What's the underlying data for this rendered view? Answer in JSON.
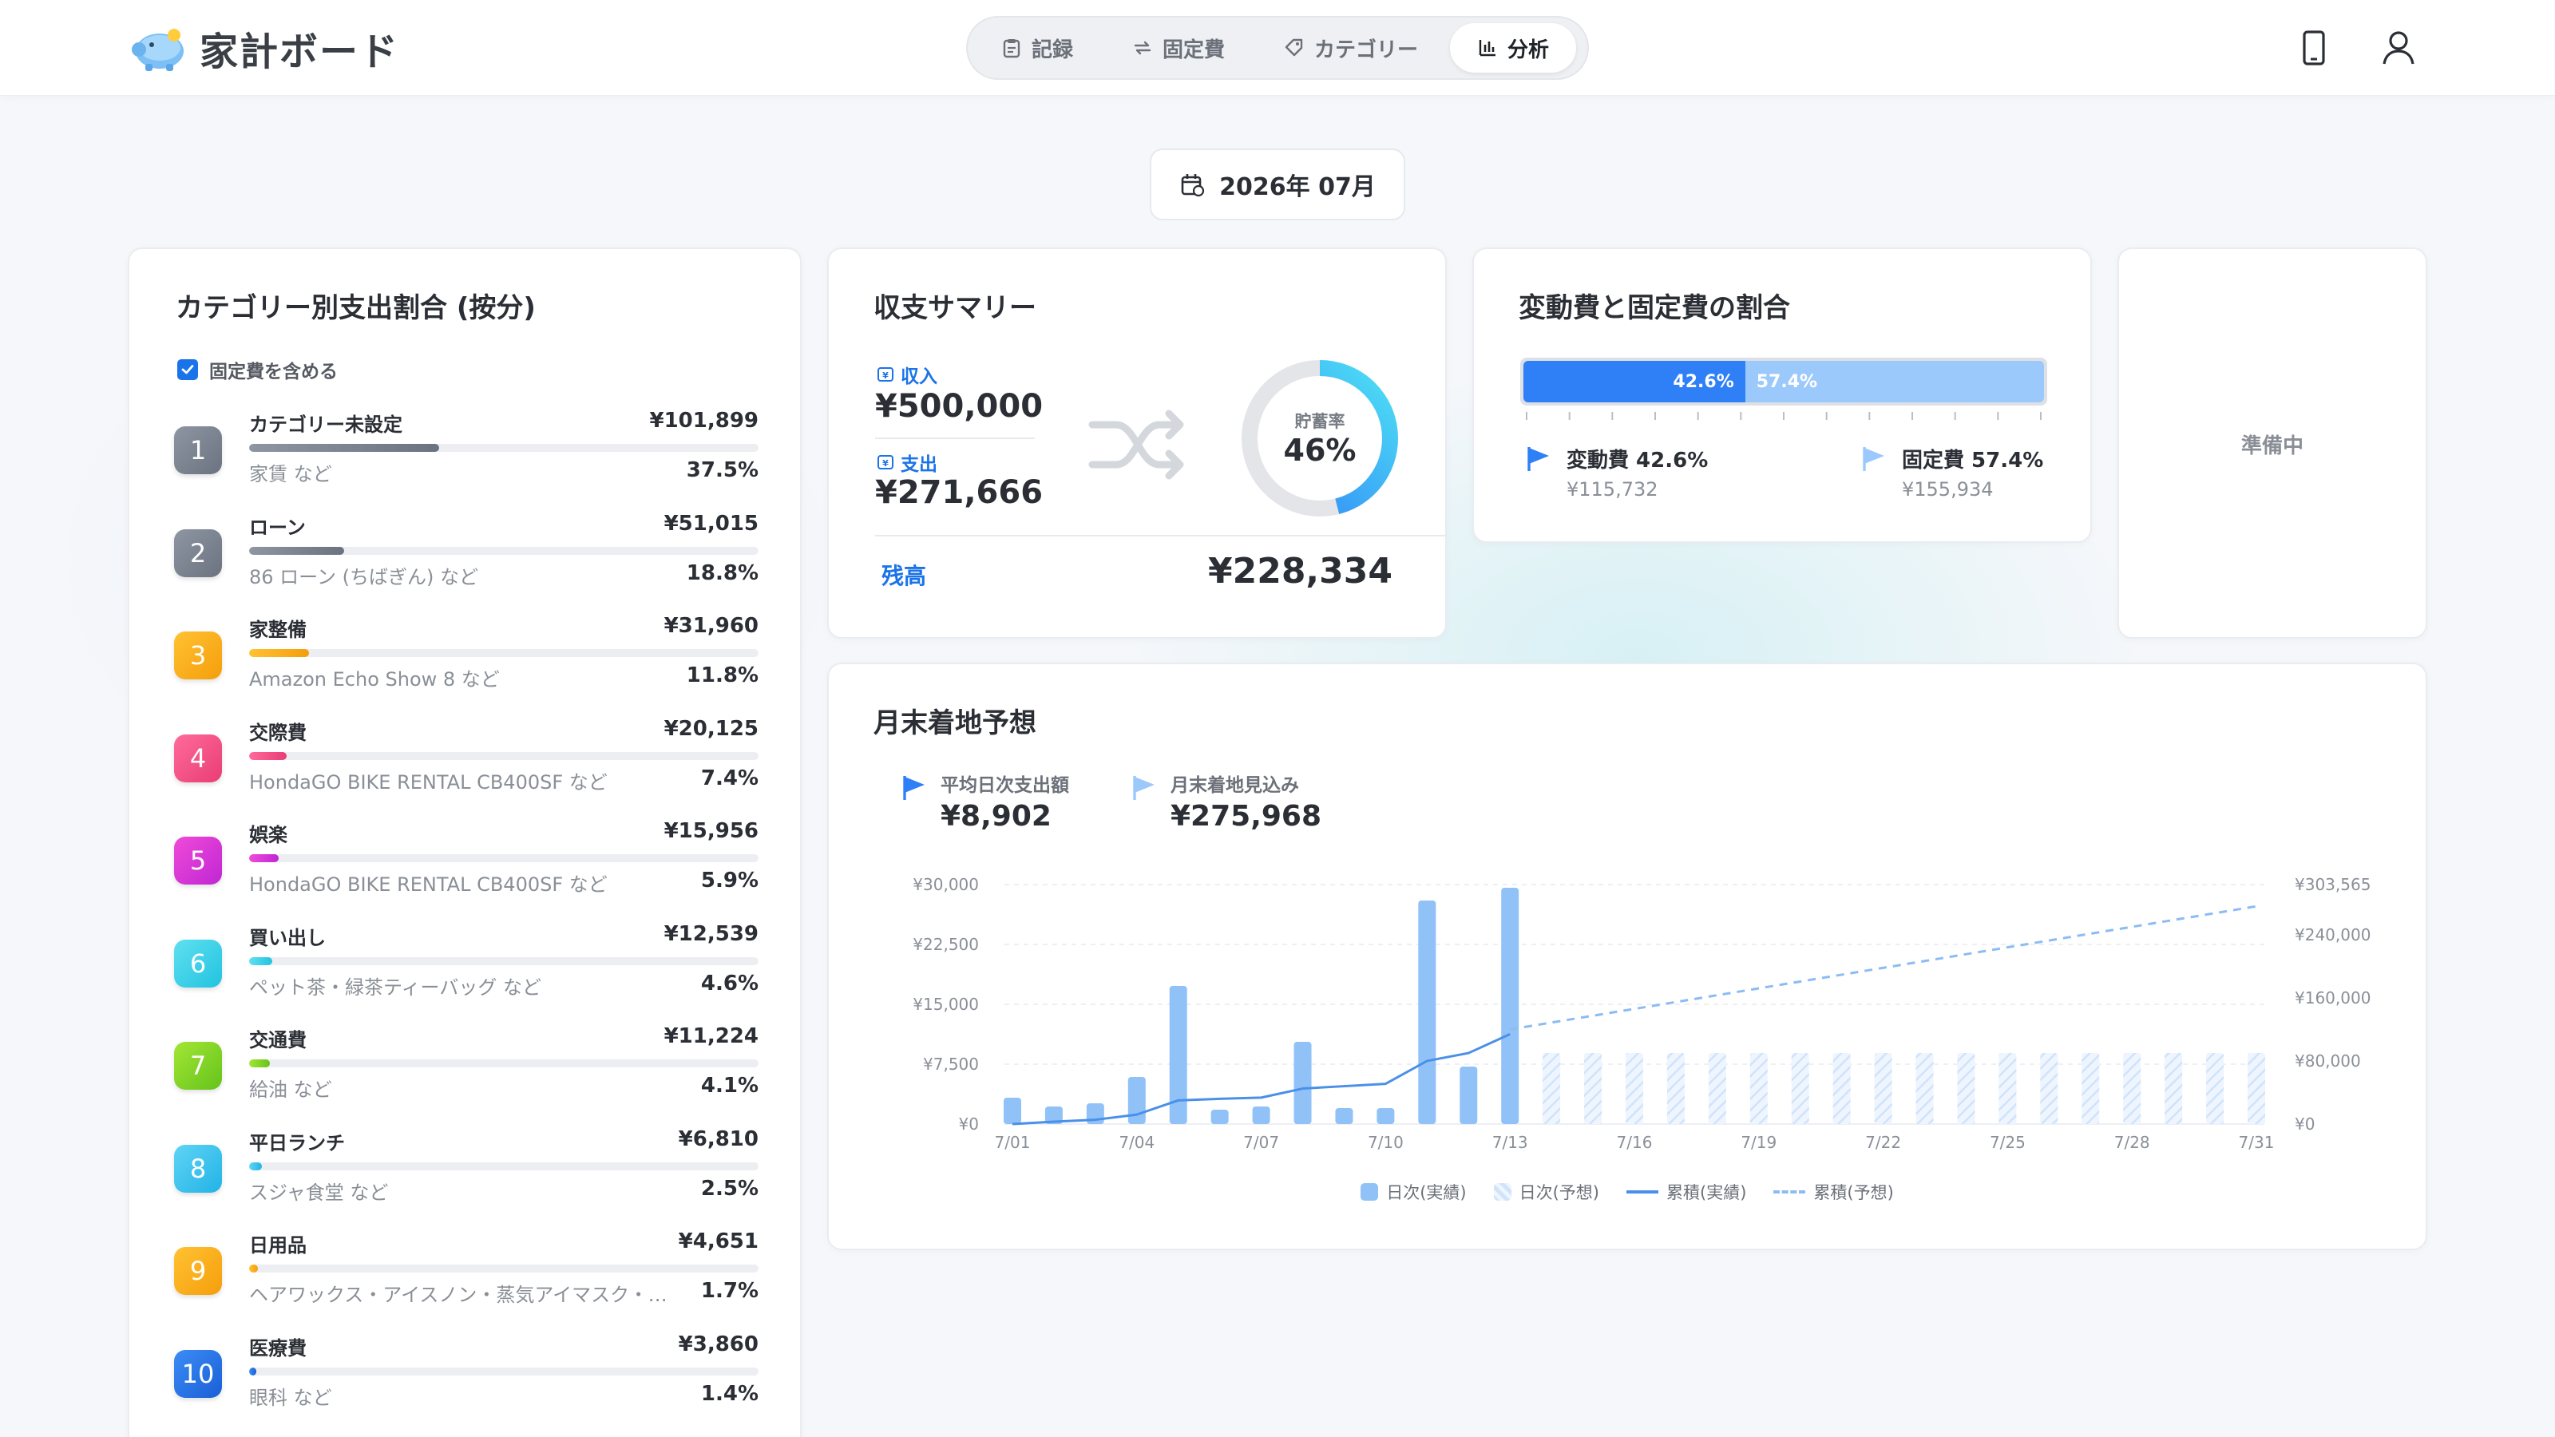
{
  "app": {
    "title": "家計ボード"
  },
  "nav": {
    "items": [
      {
        "label": "記録",
        "icon": "clipboard-icon"
      },
      {
        "label": "固定費",
        "icon": "repeat-icon"
      },
      {
        "label": "カテゴリー",
        "icon": "tag-icon"
      },
      {
        "label": "分析",
        "icon": "bar-chart-icon",
        "active": true
      }
    ]
  },
  "month": {
    "label": "2026年 07月"
  },
  "category_card": {
    "title": "カテゴリー別支出割合 (按分)",
    "checkbox_label": "固定費を含める",
    "checked": true,
    "items": [
      {
        "rank": "1",
        "name": "カテゴリー未設定",
        "amount": "¥101,899",
        "sub": "家賃 など",
        "pct": "37.5%",
        "share": 37.5,
        "color": "#8e96a3",
        "color2": "#6b7380"
      },
      {
        "rank": "2",
        "name": "ローン",
        "amount": "¥51,015",
        "sub": "86 ローン (ちばぎん) など",
        "pct": "18.8%",
        "share": 18.8,
        "color": "#8e96a3",
        "color2": "#6b7380"
      },
      {
        "rank": "3",
        "name": "家整備",
        "amount": "¥31,960",
        "sub": "Amazon Echo Show 8 など",
        "pct": "11.8%",
        "share": 11.8,
        "color": "#ffc233",
        "color2": "#f59e0b"
      },
      {
        "rank": "4",
        "name": "交際費",
        "amount": "¥20,125",
        "sub": "HondaGO BIKE RENTAL CB400SF など",
        "pct": "7.4%",
        "share": 7.4,
        "color": "#ff6b9a",
        "color2": "#e93d76"
      },
      {
        "rank": "5",
        "name": "娯楽",
        "amount": "¥15,956",
        "sub": "HondaGO BIKE RENTAL CB400SF など",
        "pct": "5.9%",
        "share": 5.9,
        "color": "#f04ad8",
        "color2": "#c026d3"
      },
      {
        "rank": "6",
        "name": "買い出し",
        "amount": "¥12,539",
        "sub": "ペット茶・緑茶ティーバッグ など",
        "pct": "4.6%",
        "share": 4.6,
        "color": "#5fe0f0",
        "color2": "#22c3e0"
      },
      {
        "rank": "7",
        "name": "交通費",
        "amount": "¥11,224",
        "sub": "給油 など",
        "pct": "4.1%",
        "share": 4.1,
        "color": "#a3e635",
        "color2": "#65c31b"
      },
      {
        "rank": "8",
        "name": "平日ランチ",
        "amount": "¥6,810",
        "sub": "スジャ食堂 など",
        "pct": "2.5%",
        "share": 2.5,
        "color": "#5fd4f5",
        "color2": "#22b3e6"
      },
      {
        "rank": "9",
        "name": "日用品",
        "amount": "¥4,651",
        "sub": "ヘアワックス・アイスノン・蒸気アイマスク・…",
        "pct": "1.7%",
        "share": 1.7,
        "color": "#ffc233",
        "color2": "#f59e0b"
      },
      {
        "rank": "10",
        "name": "医療費",
        "amount": "¥3,860",
        "sub": "眼科 など",
        "pct": "1.4%",
        "share": 1.4,
        "color": "#3b8cf5",
        "color2": "#1a5fd6"
      }
    ]
  },
  "summary": {
    "title": "収支サマリー",
    "income_label": "収入",
    "income": "¥500,000",
    "expense_label": "支出",
    "expense": "¥271,666",
    "savings_label": "貯蓄率",
    "savings_rate": "46%",
    "savings_value": 46,
    "balance_label": "残高",
    "balance": "¥228,334"
  },
  "ratio": {
    "title": "変動費と固定費の割合",
    "variable_pct": "42.6%",
    "fixed_pct": "57.4%",
    "variable_share": 42.6,
    "variable_label": "変動費 42.6%",
    "variable_amount": "¥115,732",
    "fixed_label": "固定費 57.4%",
    "fixed_amount": "¥155,934",
    "variable_color": "#2f7ff7",
    "fixed_color": "#9cc9fb"
  },
  "pending": {
    "label": "準備中"
  },
  "forecast": {
    "title": "月末着地予想",
    "avg_label": "平均日次支出額",
    "avg_value": "¥8,902",
    "proj_label": "月末着地見込み",
    "proj_value": "¥275,968",
    "legend": {
      "daily_actual": "日次(実績)",
      "daily_forecast": "日次(予想)",
      "cum_actual": "累積(実績)",
      "cum_forecast": "累積(予想)"
    }
  },
  "chart_data": {
    "type": "bar",
    "xlabel": "",
    "ylabel": "",
    "x": [
      "7/01",
      "7/02",
      "7/03",
      "7/04",
      "7/05",
      "7/06",
      "7/07",
      "7/08",
      "7/09",
      "7/10",
      "7/11",
      "7/12",
      "7/13",
      "7/14",
      "7/15",
      "7/16",
      "7/17",
      "7/18",
      "7/19",
      "7/20",
      "7/21",
      "7/22",
      "7/23",
      "7/24",
      "7/25",
      "7/26",
      "7/27",
      "7/28",
      "7/29",
      "7/30",
      "7/31"
    ],
    "x_tick_labels": [
      "7/01",
      "7/04",
      "7/07",
      "7/10",
      "7/13",
      "7/16",
      "7/19",
      "7/22",
      "7/25",
      "7/28",
      "7/31"
    ],
    "y_left_ticks": [
      "¥0",
      "¥7,500",
      "¥15,000",
      "¥22,500",
      "¥30,000"
    ],
    "y_left_lim": [
      0,
      30000
    ],
    "y_right_ticks": [
      "¥0",
      "¥80,000",
      "¥160,000",
      "¥240,000",
      "¥303,565"
    ],
    "y_right_lim": [
      0,
      303565
    ],
    "series": [
      {
        "name": "日次(実績)",
        "type": "bar",
        "values": [
          3300,
          2200,
          2600,
          5900,
          17300,
          1800,
          2200,
          10300,
          2000,
          2000,
          28000,
          7200,
          29600
        ]
      },
      {
        "name": "日次(予想)",
        "type": "bar",
        "values": [
          8902,
          8902,
          8902,
          8902,
          8902,
          8902,
          8902,
          8902,
          8902,
          8902,
          8902,
          8902,
          8902,
          8902,
          8902,
          8902,
          8902,
          8902
        ]
      },
      {
        "name": "累積(実績)",
        "type": "line",
        "values": [
          0,
          3000,
          5500,
          12000,
          30000,
          32000,
          33500,
          45000,
          48000,
          51000,
          80000,
          90000,
          114000
        ]
      },
      {
        "name": "累積(予想)",
        "type": "line",
        "x_range": [
          "7/13",
          "7/31"
        ],
        "values": [
          120000,
          275968
        ]
      }
    ],
    "grid": true,
    "legend": "bottom"
  }
}
